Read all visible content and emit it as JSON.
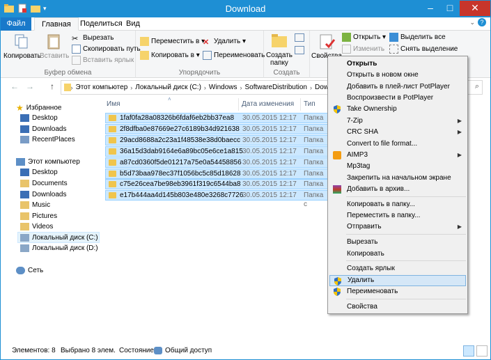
{
  "window": {
    "title": "Download"
  },
  "ribbon_tabs": [
    {
      "label": "Файл"
    },
    {
      "label": "Главная"
    },
    {
      "label": "Поделиться"
    },
    {
      "label": "Вид"
    }
  ],
  "ribbon": {
    "clipboard": {
      "copy": "Копировать",
      "paste": "Вставить",
      "cut": "Вырезать",
      "copy_path": "Скопировать путь",
      "paste_shortcut": "Вставить ярлык",
      "label": "Буфер обмена"
    },
    "organize": {
      "move_to": "Переместить в",
      "copy_to": "Копировать в",
      "delete": "Удалить",
      "rename": "Переименовать",
      "label": "Упорядочить"
    },
    "new": {
      "new_folder": "Создать папку",
      "label": "Создать"
    },
    "open": {
      "properties": "Свойства",
      "open": "Открыть",
      "edit": "Изменить"
    },
    "select": {
      "select_all": "Выделить все",
      "select_none": "Снять выделение"
    }
  },
  "address": {
    "crumbs": [
      "Этот компьютер",
      "Локальный диск (C:)",
      "Windows",
      "SoftwareDistribution",
      "Dow"
    ]
  },
  "nav": {
    "favorites": "Избранное",
    "fav_items": [
      "Desktop",
      "Downloads",
      "RecentPlaces"
    ],
    "this_pc": "Этот компьютер",
    "pc_items": [
      "Desktop",
      "Documents",
      "Downloads",
      "Music",
      "Pictures",
      "Videos",
      "Локальный диск (C:)",
      "Локальный диск (D:)"
    ],
    "network": "Сеть"
  },
  "columns": {
    "name": "Имя",
    "date": "Дата изменения",
    "type": "Тип"
  },
  "files": [
    {
      "name": "1faf0fa28a08326b6fdaf6eb2bb37ea8",
      "date": "30.05.2015 12:17",
      "type": "Папка с"
    },
    {
      "name": "2f8dfba0e87669e27c6189b34d921638",
      "date": "30.05.2015 12:17",
      "type": "Папка с"
    },
    {
      "name": "29acd8688a2c23a1f48538e38d0baecc",
      "date": "30.05.2015 12:17",
      "type": "Папка с"
    },
    {
      "name": "36a15d3dab9164e6a89bc05e6ce1a815",
      "date": "30.05.2015 12:17",
      "type": "Папка с"
    },
    {
      "name": "a87cd0360f5de01217a75e0a54458856",
      "date": "30.05.2015 12:17",
      "type": "Папка с"
    },
    {
      "name": "b5d73baa978ec37f1056bc5c85d18628",
      "date": "30.05.2015 12:17",
      "type": "Папка с"
    },
    {
      "name": "c75e26cea7be98eb3961f319c6544ba8",
      "date": "30.05.2015 12:17",
      "type": "Папка с"
    },
    {
      "name": "e17b444aa4d145b803e480e3268c7726",
      "date": "30.05.2015 12:17",
      "type": "Папка с"
    }
  ],
  "status": {
    "items": "Элементов: 8",
    "selected": "Выбрано 8 элем.",
    "state_label": "Состояние:",
    "state_value": "Общий доступ"
  },
  "context_menu": {
    "items": [
      {
        "label": "Открыть",
        "bold": true
      },
      {
        "label": "Открыть в новом окне"
      },
      {
        "label": "Добавить в плей-лист PotPlayer"
      },
      {
        "label": "Воспроизвести в PotPlayer"
      },
      {
        "label": "Take Ownership",
        "icon": "shield-icon"
      },
      {
        "label": "7-Zip",
        "submenu": true
      },
      {
        "label": "CRC SHA",
        "submenu": true
      },
      {
        "label": "Convert to file format..."
      },
      {
        "label": "AIMP3",
        "submenu": true,
        "icon": "aimp-icon"
      },
      {
        "label": "Mp3tag"
      },
      {
        "label": "Закрепить на начальном экране"
      },
      {
        "label": "Добавить в архив...",
        "icon": "winrar-icon"
      },
      {
        "label": "Копировать в папку..."
      },
      {
        "label": "Переместить в папку..."
      },
      {
        "label": "Отправить",
        "submenu": true
      },
      {
        "label": "Вырезать"
      },
      {
        "label": "Копировать"
      },
      {
        "label": "Создать ярлык"
      },
      {
        "label": "Удалить",
        "icon": "shield-icon",
        "highlighted": true
      },
      {
        "label": "Переименовать",
        "icon": "shield-icon"
      },
      {
        "label": "Свойства"
      }
    ]
  },
  "colors": {
    "accent": "#1e8fd4",
    "selection": "#cce8ff",
    "close": "#c7352b"
  }
}
